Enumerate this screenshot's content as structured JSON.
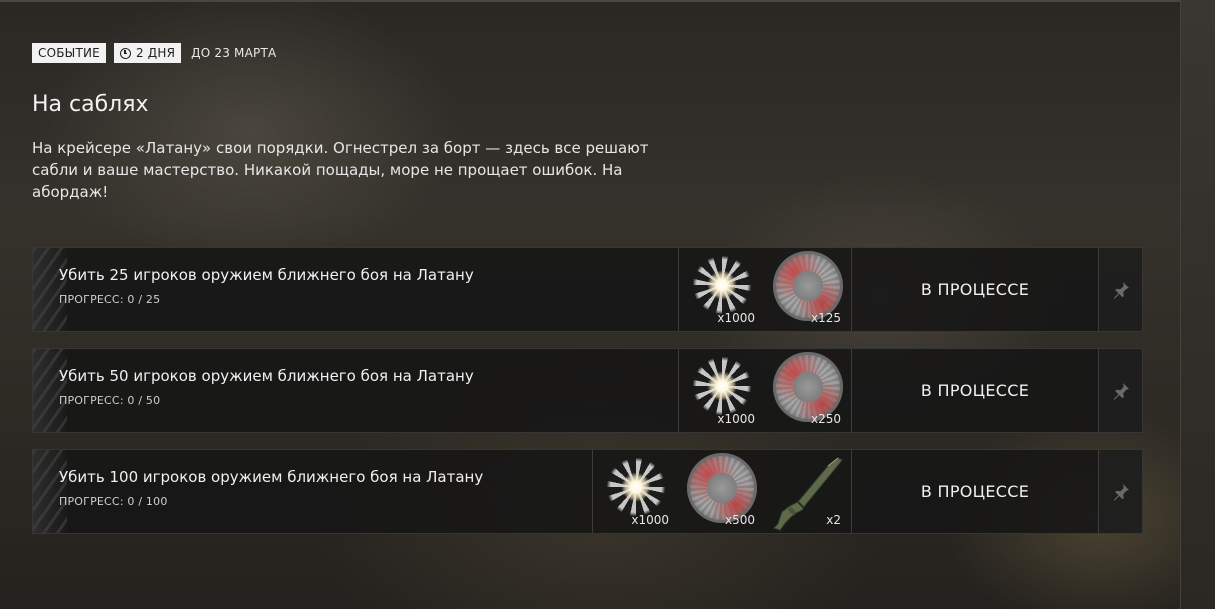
{
  "event": {
    "badge_label": "СОБЫТИЕ",
    "time_left": "2 ДНЯ",
    "until_text": "ДО 23 МАРТА",
    "title": "На саблях",
    "description": "На крейсере «Латану» свои порядки. Огнестрел за борт — здесь все решают сабли и ваше мастерство. Никакой пощады, море не прощает ошибок. На абордаж!"
  },
  "tasks": [
    {
      "title": "Убить 25 игроков оружием ближнего боя на Латану",
      "progress": "ПРОГРЕСС: 0 / 25",
      "status": "В ПРОЦЕССЕ",
      "rewards": [
        {
          "icon": "sparkle-reward-icon",
          "qty": "x1000"
        },
        {
          "icon": "coin-reward-icon",
          "qty": "x125"
        }
      ]
    },
    {
      "title": "Убить 50 игроков оружием ближнего боя на Латану",
      "progress": "ПРОГРЕСС: 0 / 50",
      "status": "В ПРОЦЕССЕ",
      "rewards": [
        {
          "icon": "sparkle-reward-icon",
          "qty": "x1000"
        },
        {
          "icon": "coin-reward-icon",
          "qty": "x250"
        }
      ]
    },
    {
      "title": "Убить 100 игроков оружием ближнего боя на Латану",
      "progress": "ПРОГРЕСС: 0 / 100",
      "status": "В ПРОЦЕССЕ",
      "rewards": [
        {
          "icon": "sparkle-reward-icon",
          "qty": "x1000"
        },
        {
          "icon": "coin-reward-icon",
          "qty": "x500"
        },
        {
          "icon": "weapon-reward-icon",
          "qty": "x2"
        }
      ]
    }
  ]
}
